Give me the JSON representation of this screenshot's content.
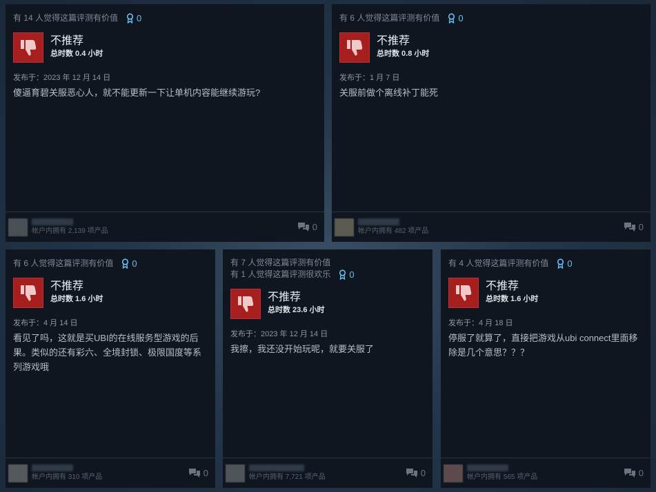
{
  "colors": {
    "background": "#22354a",
    "card": "#0f1620",
    "thumb_down": "#a61e1e",
    "award_accent": "#66c0f4"
  },
  "reviews": [
    {
      "helpful": [
        "有 14 人觉得这篇评测有价值"
      ],
      "awards": "0",
      "recommendation": "不推荐",
      "hours": "总时数 0.4 小时",
      "posted": "发布于：2023 年 12 月 14 日",
      "text": "傻逼育碧关服恶心人，就不能更新一下让单机内容能继续游玩?",
      "products": "帐户内拥有 2,139 项产品",
      "comments": "0",
      "thumb_icon": "thumbs-down-icon"
    },
    {
      "helpful": [
        "有 6 人觉得这篇评测有价值"
      ],
      "awards": "0",
      "recommendation": "不推荐",
      "hours": "总时数 0.8 小时",
      "posted": "发布于：1 月 7 日",
      "text": "关服前做个离线补丁能死",
      "products": "帐户内拥有 482 项产品",
      "comments": "0",
      "thumb_icon": "thumbs-down-icon"
    },
    {
      "helpful": [
        "有 6 人觉得这篇评测有价值"
      ],
      "awards": "0",
      "recommendation": "不推荐",
      "hours": "总时数 1.6 小时",
      "posted": "发布于：4 月 14 日",
      "text": "看见了吗，这就是买UBI的在线服务型游戏的后果。类似的还有彩六、全境封锁、极限国度等系列游戏哦",
      "products": "帐户内拥有 310 项产品",
      "comments": "0",
      "thumb_icon": "thumbs-down-icon"
    },
    {
      "helpful": [
        "有 7 人觉得这篇评测有价值",
        "有 1 人觉得这篇评测很欢乐"
      ],
      "awards": "0",
      "recommendation": "不推荐",
      "hours": "总时数 23.6 小时",
      "posted": "发布于：2023 年 12 月 14 日",
      "text": "我擦，我还没开始玩呢，就要关服了",
      "products": "帐户内拥有 7,721 项产品",
      "comments": "0",
      "thumb_icon": "thumbs-down-icon"
    },
    {
      "helpful": [
        "有 4 人觉得这篇评测有价值"
      ],
      "awards": "0",
      "recommendation": "不推荐",
      "hours": "总时数 1.6 小时",
      "posted": "发布于：4 月 18 日",
      "text": "停服了就算了，直接把游戏从ubi connect里面移除是几个意思？？？",
      "products": "帐户内拥有 565 项产品",
      "comments": "0",
      "thumb_icon": "thumbs-down-icon"
    }
  ]
}
